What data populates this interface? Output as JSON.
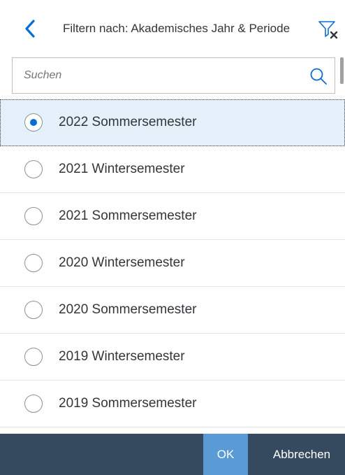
{
  "header": {
    "title": "Filtern nach: Akademisches Jahr & Periode",
    "back_icon": "chevron-left-icon",
    "clear_filter_icon": "filter-clear-icon"
  },
  "search": {
    "placeholder": "Suchen",
    "value": "",
    "icon": "search-icon"
  },
  "list": {
    "items": [
      {
        "label": "2022 Sommersemester",
        "selected": true
      },
      {
        "label": "2021 Wintersemester",
        "selected": false
      },
      {
        "label": "2021 Sommersemester",
        "selected": false
      },
      {
        "label": "2020 Wintersemester",
        "selected": false
      },
      {
        "label": "2020 Sommersemester",
        "selected": false
      },
      {
        "label": "2019 Wintersemester",
        "selected": false
      },
      {
        "label": "2019 Sommersemester",
        "selected": false
      }
    ]
  },
  "footer": {
    "ok_label": "OK",
    "cancel_label": "Abbrechen"
  },
  "colors": {
    "accent": "#0a6ed1",
    "selected_row": "#e5f0fa",
    "footer_bg": "#354a5f",
    "ok_button": "#5b9bd5"
  }
}
